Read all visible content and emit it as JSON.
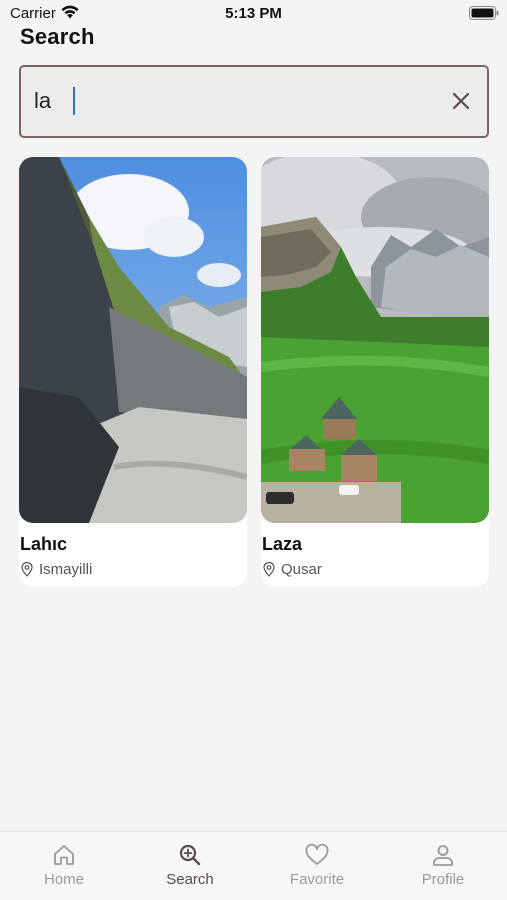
{
  "status_bar": {
    "carrier": "Carrier",
    "time": "5:13 PM"
  },
  "header": {
    "title": "Search"
  },
  "search": {
    "value": "la",
    "placeholder": ""
  },
  "results": [
    {
      "title": "Lahıc",
      "location": "Ismayilli"
    },
    {
      "title": "Laza",
      "location": "Qusar"
    }
  ],
  "tabs": [
    {
      "label": "Home",
      "icon": "home-icon",
      "active": false
    },
    {
      "label": "Search",
      "icon": "search-icon",
      "active": true
    },
    {
      "label": "Favorite",
      "icon": "heart-icon",
      "active": false
    },
    {
      "label": "Profile",
      "icon": "user-icon",
      "active": false
    }
  ],
  "colors": {
    "accent": "#5a4a4a",
    "search_border": "#7a6565",
    "inactive_tab": "#9a9a9a"
  }
}
